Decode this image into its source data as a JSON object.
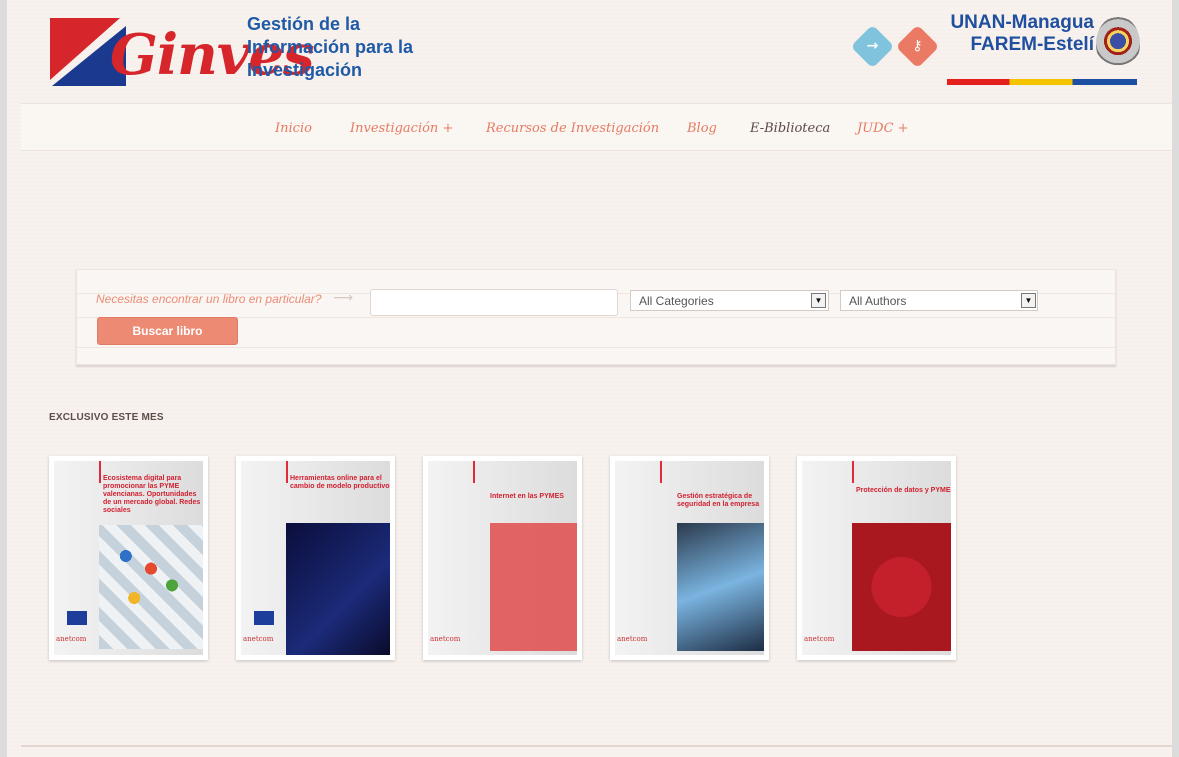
{
  "header": {
    "logo_text": "Ginves",
    "site_title_lines": [
      "Gestión de la",
      "Información para la",
      "Investigación"
    ],
    "login_icon": "sign-in-icon",
    "search_icon": "key-icon",
    "university_lines": [
      "UNAN-Managua",
      "FAREM-Estelí"
    ],
    "flag_colors": [
      "#e3201b",
      "#f5c400",
      "#1c4fa1"
    ]
  },
  "nav": {
    "items": [
      {
        "label": "Inicio"
      },
      {
        "label": "Investigación +"
      },
      {
        "label": "Recursos de Investigación"
      },
      {
        "label": "Blog"
      },
      {
        "label": "E-Biblioteca"
      },
      {
        "label": "JUDC +"
      }
    ],
    "active_index": 4
  },
  "search": {
    "hint": "Necesitas encontrar un libro en particular?",
    "input_value": "",
    "categories_selected": "All Categories",
    "authors_selected": "All Authors",
    "button_label": "Buscar libro"
  },
  "section": {
    "heading": "EXCLUSIVO ESTE MES"
  },
  "books": [
    {
      "title": "Ecosistema digital para promocionar las PYME valencianas. Oportunidades de un mercado global. Redes sociales",
      "publisher": "anetcom"
    },
    {
      "title": "Herramientas online para el cambio de modelo productivo",
      "publisher": "anetcom"
    },
    {
      "title": "Internet en las PYMES",
      "publisher": "anetcom"
    },
    {
      "title": "Gestión estratégica de seguridad en la empresa",
      "publisher": "anetcom"
    },
    {
      "title": "Protección de datos y PYMES",
      "publisher": "anetcom"
    }
  ],
  "colors": {
    "accent": "#e57b63",
    "brand_blue": "#1f5aa6",
    "button": "#ed8a74",
    "background": "#f6efeb"
  }
}
